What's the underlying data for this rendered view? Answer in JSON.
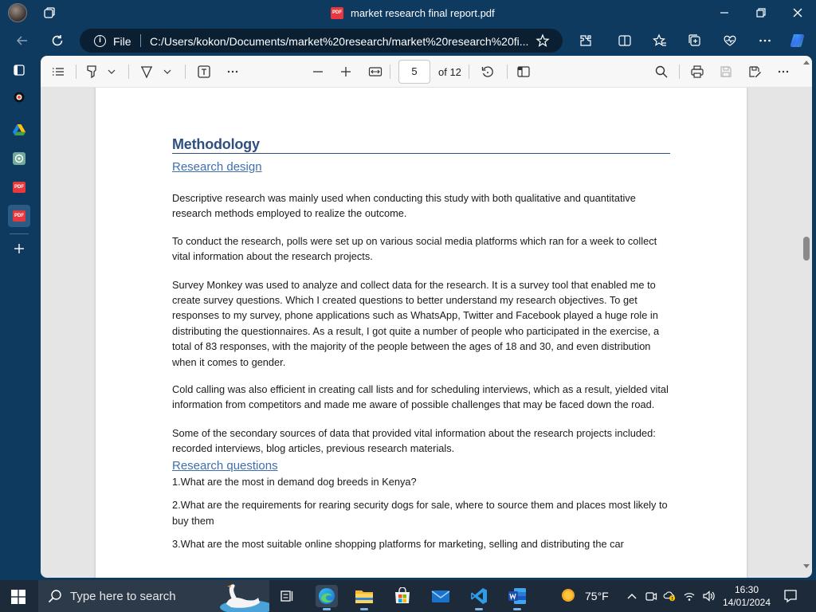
{
  "window": {
    "title": "market research final report.pdf"
  },
  "address_bar": {
    "scheme_label": "File",
    "url": "C:/Users/kokon/Documents/market%20research/market%20research%20fi..."
  },
  "pdf_toolbar": {
    "current_page": "5",
    "page_count": "of 12"
  },
  "document": {
    "heading": "Methodology",
    "subheading_design": "Research design",
    "p1": "Descriptive research was mainly used when conducting this study with both qualitative and quantitative research methods employed to realize the outcome.",
    "p2": "To conduct the research, polls were set up on various social media platforms which ran for a week to collect vital information about the research projects.",
    "p3": "Survey Monkey was used to analyze and collect data for the research. It is a survey tool that enabled me to create survey questions. Which I created questions to better understand my research objectives. To get responses to my survey, phone applications such as WhatsApp, Twitter and Facebook played a huge role in distributing the questionnaires.  As a result, I got quite a number of people who participated in the exercise, a total of 83 responses, with the majority of the people between the ages of 18 and 30, and even distribution when it comes to gender.",
    "p4": "Cold calling was also efficient in creating call lists and for scheduling interviews, which as a result, yielded vital information from competitors and made me aware of possible challenges that may be faced down the road.",
    "p5": " Some of the secondary sources of data that provided vital information about the research projects included: recorded interviews, blog articles, previous research materials.",
    "subheading_questions": "Research questions",
    "q1": "1.What are the most in demand dog breeds in Kenya?",
    "q2": "2.What are the requirements for rearing security dogs for sale, where to source them and places most likely to buy them",
    "q3": "3.What are the most suitable online shopping platforms for marketing, selling and distributing the car"
  },
  "taskbar": {
    "search_placeholder": "Type here to search",
    "weather_temp": "75°F",
    "time": "16:30",
    "date": "14/01/2024"
  },
  "colors": {
    "chrome": "#0f3a5f",
    "heading": "#2f4f7f",
    "subheading": "#3f6fb0",
    "pdf_red": "#e8383d"
  }
}
